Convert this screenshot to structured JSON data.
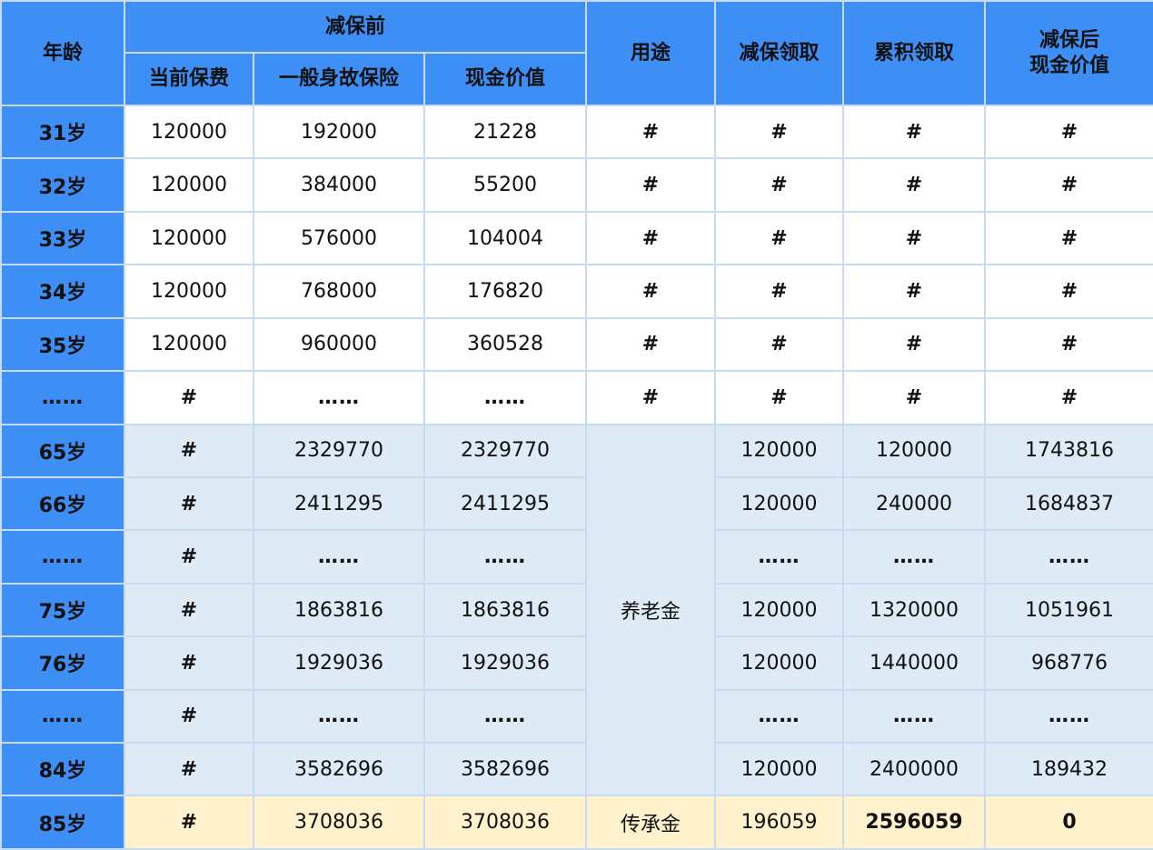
{
  "header": {
    "age": "年龄",
    "before_group": "减保前",
    "premium": "当前保费",
    "death_benefit": "一般身故保险",
    "cash_value": "现金价值",
    "usage": "用途",
    "withdraw": "减保领取",
    "cumulative": "累积领取",
    "after_cash_line1": "减保后",
    "after_cash_line2": "现金价值"
  },
  "usage_labels": {
    "pension": "养老金",
    "legacy": "传承金"
  },
  "rows": [
    {
      "age": "31岁",
      "premium": "120000",
      "death": "192000",
      "cash": "21228",
      "usage": "#",
      "withdraw": "#",
      "cumulative": "#",
      "after": "#"
    },
    {
      "age": "32岁",
      "premium": "120000",
      "death": "384000",
      "cash": "55200",
      "usage": "#",
      "withdraw": "#",
      "cumulative": "#",
      "after": "#"
    },
    {
      "age": "33岁",
      "premium": "120000",
      "death": "576000",
      "cash": "104004",
      "usage": "#",
      "withdraw": "#",
      "cumulative": "#",
      "after": "#"
    },
    {
      "age": "34岁",
      "premium": "120000",
      "death": "768000",
      "cash": "176820",
      "usage": "#",
      "withdraw": "#",
      "cumulative": "#",
      "after": "#"
    },
    {
      "age": "35岁",
      "premium": "120000",
      "death": "960000",
      "cash": "360528",
      "usage": "#",
      "withdraw": "#",
      "cumulative": "#",
      "after": "#"
    },
    {
      "age": "……",
      "premium": "#",
      "death": "……",
      "cash": "……",
      "usage": "#",
      "withdraw": "#",
      "cumulative": "#",
      "after": "#"
    },
    {
      "age": "65岁",
      "premium": "#",
      "death": "2329770",
      "cash": "2329770",
      "withdraw": "120000",
      "cumulative": "120000",
      "after": "1743816"
    },
    {
      "age": "66岁",
      "premium": "#",
      "death": "2411295",
      "cash": "2411295",
      "withdraw": "120000",
      "cumulative": "240000",
      "after": "1684837"
    },
    {
      "age": "……",
      "premium": "#",
      "death": "……",
      "cash": "……",
      "withdraw": "……",
      "cumulative": "……",
      "after": "……"
    },
    {
      "age": "75岁",
      "premium": "#",
      "death": "1863816",
      "cash": "1863816",
      "withdraw": "120000",
      "cumulative": "1320000",
      "after": "1051961"
    },
    {
      "age": "76岁",
      "premium": "#",
      "death": "1929036",
      "cash": "1929036",
      "withdraw": "120000",
      "cumulative": "1440000",
      "after": "968776"
    },
    {
      "age": "……",
      "premium": "#",
      "death": "……",
      "cash": "……",
      "withdraw": "……",
      "cumulative": "……",
      "after": "……"
    },
    {
      "age": "84岁",
      "premium": "#",
      "death": "3582696",
      "cash": "3582696",
      "withdraw": "120000",
      "cumulative": "2400000",
      "after": "189432"
    },
    {
      "age": "85岁",
      "premium": "#",
      "death": "3708036",
      "cash": "3708036",
      "withdraw": "196059",
      "cumulative": "2596059",
      "after": "0"
    }
  ],
  "colors": {
    "header_blue": "#3d8ef5",
    "row_blue": "#deebf7",
    "row_yellow": "#fff2cc",
    "grid_line": "#c7dcf3",
    "highlight_red": "#e8140c"
  }
}
